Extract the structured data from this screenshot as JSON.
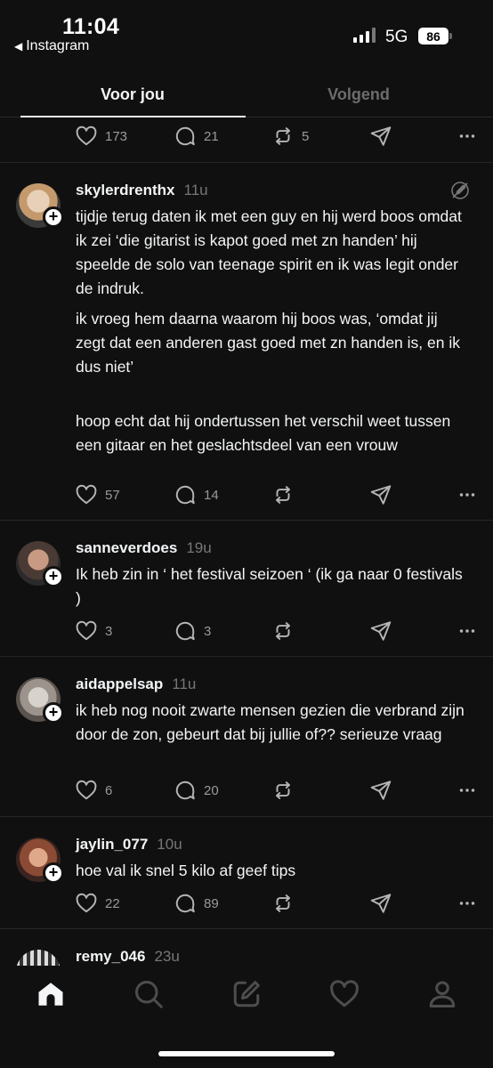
{
  "status_bar": {
    "time": "11:04",
    "back_app": "Instagram",
    "network": "5G",
    "battery": "86"
  },
  "tabs": [
    {
      "label": "Voor jou",
      "active": true
    },
    {
      "label": "Volgend",
      "active": false
    }
  ],
  "previous_post_actions": {
    "likes": "173",
    "replies": "21",
    "reposts": "5"
  },
  "posts": [
    {
      "username": "skylerdrenthx",
      "time_ago": "11u",
      "paragraphs": [
        "tijdje terug daten ik met een guy en hij werd boos omdat ik zei ‘die gitarist is kapot goed met zn handen’ hij speelde de solo van teenage spirit en ik was legit onder de indruk.",
        "ik vroeg hem daarna waarom hij boos was, ‘omdat jij zegt dat een anderen gast goed met zn handen is, en ik dus niet’",
        "hoop echt dat hij ondertussen het verschil weet tussen een gitaar en het geslachtsdeel van een vrouw"
      ],
      "likes": "57",
      "replies": "14",
      "reposts": ""
    },
    {
      "username": "sanneverdoes",
      "time_ago": "19u",
      "paragraphs": [
        "Ik heb zin in ‘ het festival seizoen ‘ (ik ga naar 0 festivals )"
      ],
      "likes": "3",
      "replies": "3",
      "reposts": ""
    },
    {
      "username": "aidappelsap",
      "time_ago": "11u",
      "paragraphs": [
        "ik heb nog nooit zwarte mensen gezien die verbrand zijn door de zon, gebeurt dat bij jullie of?? serieuze vraag"
      ],
      "likes": "6",
      "replies": "20",
      "reposts": ""
    },
    {
      "username": "jaylin_077",
      "time_ago": "10u",
      "paragraphs": [
        "hoe val ik snel 5 kilo af geef tips"
      ],
      "likes": "22",
      "replies": "89",
      "reposts": ""
    },
    {
      "username": "remy_046",
      "time_ago": "23u",
      "paragraphs": [],
      "likes": "",
      "replies": "",
      "reposts": ""
    }
  ],
  "bottom_nav": [
    "home-icon",
    "search-icon",
    "compose-icon",
    "heart-icon",
    "profile-icon"
  ],
  "colors": {
    "background": "#101010",
    "text": "#f3f5f7",
    "muted": "#777777",
    "divider": "#262626"
  }
}
